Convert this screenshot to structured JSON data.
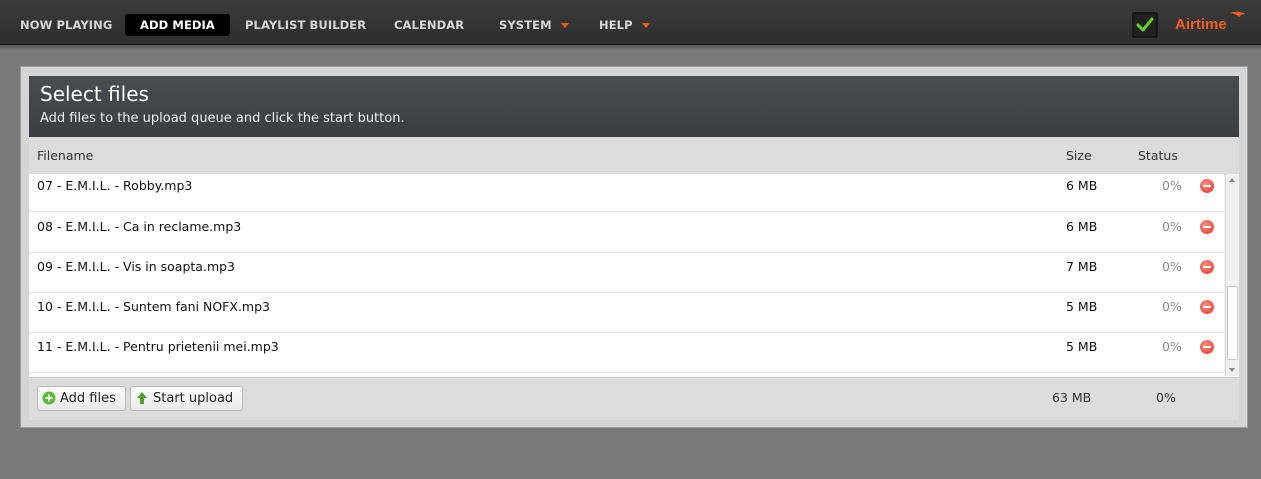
{
  "nav": {
    "items": [
      {
        "label": "NOW PLAYING",
        "active": false,
        "dropdown": false
      },
      {
        "label": "ADD MEDIA",
        "active": true,
        "dropdown": false
      },
      {
        "label": "PLAYLIST BUILDER",
        "active": false,
        "dropdown": false
      },
      {
        "label": "CALENDAR",
        "active": false,
        "dropdown": false
      },
      {
        "label": "SYSTEM",
        "active": false,
        "dropdown": true
      },
      {
        "label": "HELP",
        "active": false,
        "dropdown": true
      }
    ],
    "brand": "Airtime",
    "accent_color": "#ff5d1a"
  },
  "uploader": {
    "title": "Select files",
    "subtitle": "Add files to the upload queue and click the start button.",
    "columns": {
      "filename": "Filename",
      "size": "Size",
      "status": "Status"
    },
    "files": [
      {
        "name": "07 - E.M.I.L. - Robby.mp3",
        "size": "6 MB",
        "status": "0%"
      },
      {
        "name": "08 - E.M.I.L. - Ca in reclame.mp3",
        "size": "6 MB",
        "status": "0%"
      },
      {
        "name": "09 - E.M.I.L. - Vis in soapta.mp3",
        "size": "7 MB",
        "status": "0%"
      },
      {
        "name": "10 - E.M.I.L. - Suntem fani NOFX.mp3",
        "size": "5 MB",
        "status": "0%"
      },
      {
        "name": "11 - E.M.I.L. - Pentru prietenii mei.mp3",
        "size": "5 MB",
        "status": "0%"
      }
    ],
    "add_files_label": "Add files",
    "start_upload_label": "Start upload",
    "total_size": "63 MB",
    "total_status": "0%"
  }
}
